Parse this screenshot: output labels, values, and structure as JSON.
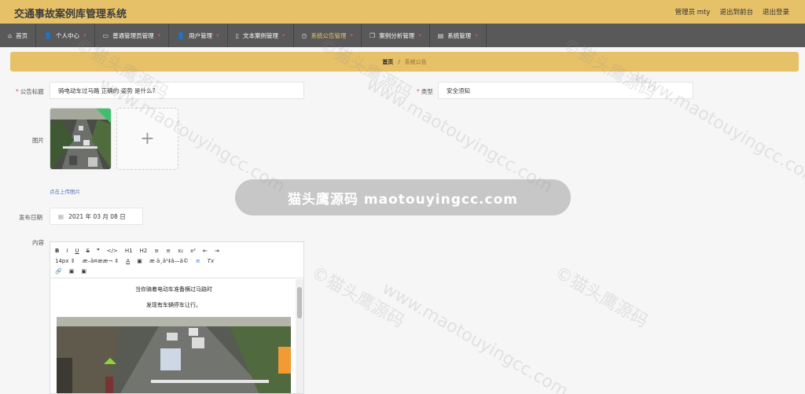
{
  "app": {
    "title": "交通事故案例库管理系统",
    "user_label": "管理员 mty",
    "back_to_front": "退出到前台",
    "logout": "退出登录"
  },
  "nav": [
    {
      "label": "首页",
      "icon": "home-icon",
      "active": false
    },
    {
      "label": "个人中心",
      "icon": "user-icon",
      "active": false
    },
    {
      "label": "普通管理员管理",
      "icon": "chat-icon",
      "active": false
    },
    {
      "label": "用户管理",
      "icon": "user-icon",
      "active": false
    },
    {
      "label": "文本案例管理",
      "icon": "phone-icon",
      "active": false
    },
    {
      "label": "系统公告管理",
      "icon": "clock-icon",
      "active": true
    },
    {
      "label": "案例分析管理",
      "icon": "copy-icon",
      "active": false
    },
    {
      "label": "系统管理",
      "icon": "list-icon",
      "active": false
    }
  ],
  "breadcrumb": {
    "home": "首页",
    "separator": "/",
    "current": "系统公告"
  },
  "form": {
    "title_label": "公告标题",
    "title_value": "骑电动车过马路 正确的 姿势 是什么?",
    "type_label": "类型",
    "type_value": "安全须知",
    "image_label": "图片",
    "upload_hint": "点击上传图片",
    "date_label": "发布日期",
    "date_value": "2021 年 03 月 08 日",
    "content_label": "内容"
  },
  "editor": {
    "row1": [
      "B",
      "I",
      "U",
      "S",
      "❞",
      "</>",
      "H1",
      "H2",
      "≡",
      "≡",
      "x₂",
      "x²",
      "⇤",
      "⇥"
    ],
    "row2": [
      "14px ⇕",
      "æ–ä¤ææ¬ ⇕",
      "A",
      "▣",
      "æ ä¸ä¹‡â—ä©",
      "≡",
      "Tx"
    ],
    "row3": [
      "🔗",
      "▣",
      "▣"
    ],
    "content_line1": "当你骑着电动车准备横过马路时",
    "content_line2": "发现有车辆停车让行。"
  },
  "watermark": {
    "banner": "猫头鹰源码 maotouyingcc.com",
    "text_cn": "©猫头鹰源码",
    "text_en": "www.maotouyingcc.com"
  },
  "colors": {
    "accent": "#e6c168",
    "nav_bg": "#595959",
    "active_nav": "#e6c168",
    "required": "#e85454"
  }
}
